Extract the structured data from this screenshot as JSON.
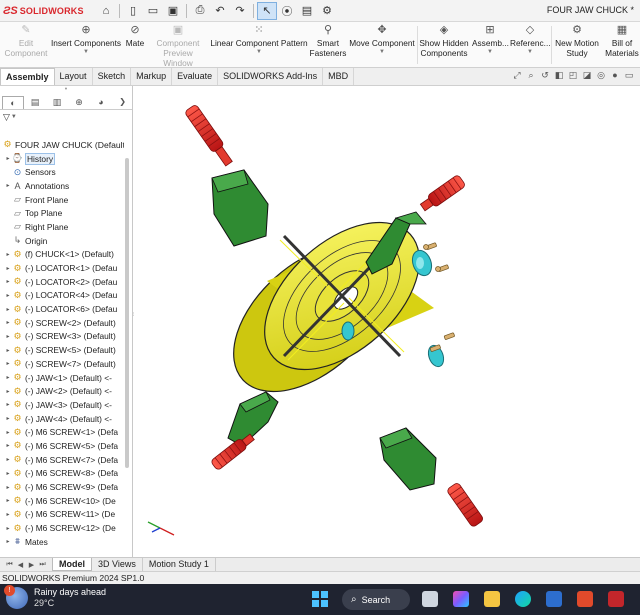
{
  "app": {
    "logo_text": "SOLIDWORKS",
    "document_title": "FOUR JAW CHUCK *"
  },
  "quick_access": [
    {
      "name": "home-icon",
      "glyph": "⌂"
    },
    {
      "name": "new-doc-icon",
      "glyph": "▯"
    },
    {
      "name": "open-folder-icon",
      "glyph": "▭"
    },
    {
      "name": "save-icon",
      "glyph": "▣"
    },
    {
      "name": "print-icon",
      "glyph": "⎙"
    },
    {
      "name": "undo-icon",
      "glyph": "↶"
    },
    {
      "name": "redo-icon",
      "glyph": "↷"
    },
    {
      "name": "select-arrow-icon",
      "glyph": "↖"
    },
    {
      "name": "traffic-light-icon",
      "glyph": "⦿"
    },
    {
      "name": "rebuild-icon",
      "glyph": "▤"
    },
    {
      "name": "options-gear-icon",
      "glyph": "⚙"
    }
  ],
  "ribbon": {
    "edit_component": [
      "Edit",
      "Component"
    ],
    "insert_components": "Insert Components",
    "mate": "Mate",
    "preview_window": [
      "Component",
      "Preview Window"
    ],
    "linear_pattern": "Linear Component Pattern",
    "smart_fasteners": [
      "Smart",
      "Fasteners"
    ],
    "move_component": "Move Component",
    "show_hidden": [
      "Show Hidden",
      "Components"
    ],
    "assembly": "Assemb...",
    "reference": "Referenc...",
    "new_motion": [
      "New Motion",
      "Study"
    ],
    "bill_of_materials": [
      "Bill of",
      "Materials"
    ]
  },
  "command_tabs": [
    "Assembly",
    "Layout",
    "Sketch",
    "Markup",
    "Evaluate",
    "SOLIDWORKS Add-Ins",
    "MBD"
  ],
  "tree": [
    {
      "label": "FOUR JAW CHUCK  (Default",
      "icon": "assembly",
      "exp": "",
      "root": true
    },
    {
      "label": "History",
      "icon": "history",
      "exp": "▸"
    },
    {
      "label": "Sensors",
      "icon": "sensor",
      "exp": ""
    },
    {
      "label": "Annotations",
      "icon": "anno",
      "exp": "▸"
    },
    {
      "label": "Front Plane",
      "icon": "plane",
      "exp": ""
    },
    {
      "label": "Top Plane",
      "icon": "plane",
      "exp": ""
    },
    {
      "label": "Right Plane",
      "icon": "plane",
      "exp": ""
    },
    {
      "label": "Origin",
      "icon": "origin",
      "exp": ""
    },
    {
      "label": "(f) CHUCK<1> (Default)",
      "icon": "part",
      "exp": "▸"
    },
    {
      "label": "(-) LOCATOR<1> (Defau",
      "icon": "part",
      "exp": "▸"
    },
    {
      "label": "(-) LOCATOR<2> (Defau",
      "icon": "part",
      "exp": "▸"
    },
    {
      "label": "(-) LOCATOR<4> (Defau",
      "icon": "part",
      "exp": "▸"
    },
    {
      "label": "(-) LOCATOR<6> (Defau",
      "icon": "part",
      "exp": "▸"
    },
    {
      "label": "(-) SCREW<2> (Default)",
      "icon": "part",
      "exp": "▸"
    },
    {
      "label": "(-) SCREW<3> (Default)",
      "icon": "part",
      "exp": "▸"
    },
    {
      "label": "(-) SCREW<5> (Default)",
      "icon": "part",
      "exp": "▸"
    },
    {
      "label": "(-) SCREW<7> (Default)",
      "icon": "part",
      "exp": "▸"
    },
    {
      "label": "(-) JAW<1> (Default) <-",
      "icon": "part",
      "exp": "▸"
    },
    {
      "label": "(-) JAW<2> (Default) <-",
      "icon": "part",
      "exp": "▸"
    },
    {
      "label": "(-) JAW<3> (Default) <-",
      "icon": "part",
      "exp": "▸"
    },
    {
      "label": "(-) JAW<4> (Default) <-",
      "icon": "part",
      "exp": "▸"
    },
    {
      "label": "(-) M6 SCREW<1> (Defa",
      "icon": "part",
      "exp": "▸"
    },
    {
      "label": "(-) M6 SCREW<5> (Defa",
      "icon": "part",
      "exp": "▸"
    },
    {
      "label": "(-) M6 SCREW<7> (Defa",
      "icon": "part",
      "exp": "▸"
    },
    {
      "label": "(-) M6 SCREW<8> (Defa",
      "icon": "part",
      "exp": "▸"
    },
    {
      "label": "(-) M6 SCREW<9> (Defa",
      "icon": "part",
      "exp": "▸"
    },
    {
      "label": "(-) M6 SCREW<10> (De",
      "icon": "part",
      "exp": "▸"
    },
    {
      "label": "(-) M6 SCREW<11> (De",
      "icon": "part",
      "exp": "▸"
    },
    {
      "label": "(-) M6 SCREW<12> (De",
      "icon": "part",
      "exp": "▸"
    },
    {
      "label": "Mates",
      "icon": "mates",
      "exp": "▸"
    }
  ],
  "bottom_tabs": [
    "Model",
    "3D Views",
    "Motion Study 1"
  ],
  "status": "SOLIDWORKS Premium 2024 SP1.0",
  "taskbar": {
    "weather_line1": "Rainy days ahead",
    "weather_line2": "29°C",
    "search_label": "Search"
  },
  "colors": {
    "chuck_body": "#f2ee1f",
    "jaw": "#2f8b32",
    "screw": "#d92424",
    "locator": "#35c6d0",
    "brand": "#d9262c"
  }
}
